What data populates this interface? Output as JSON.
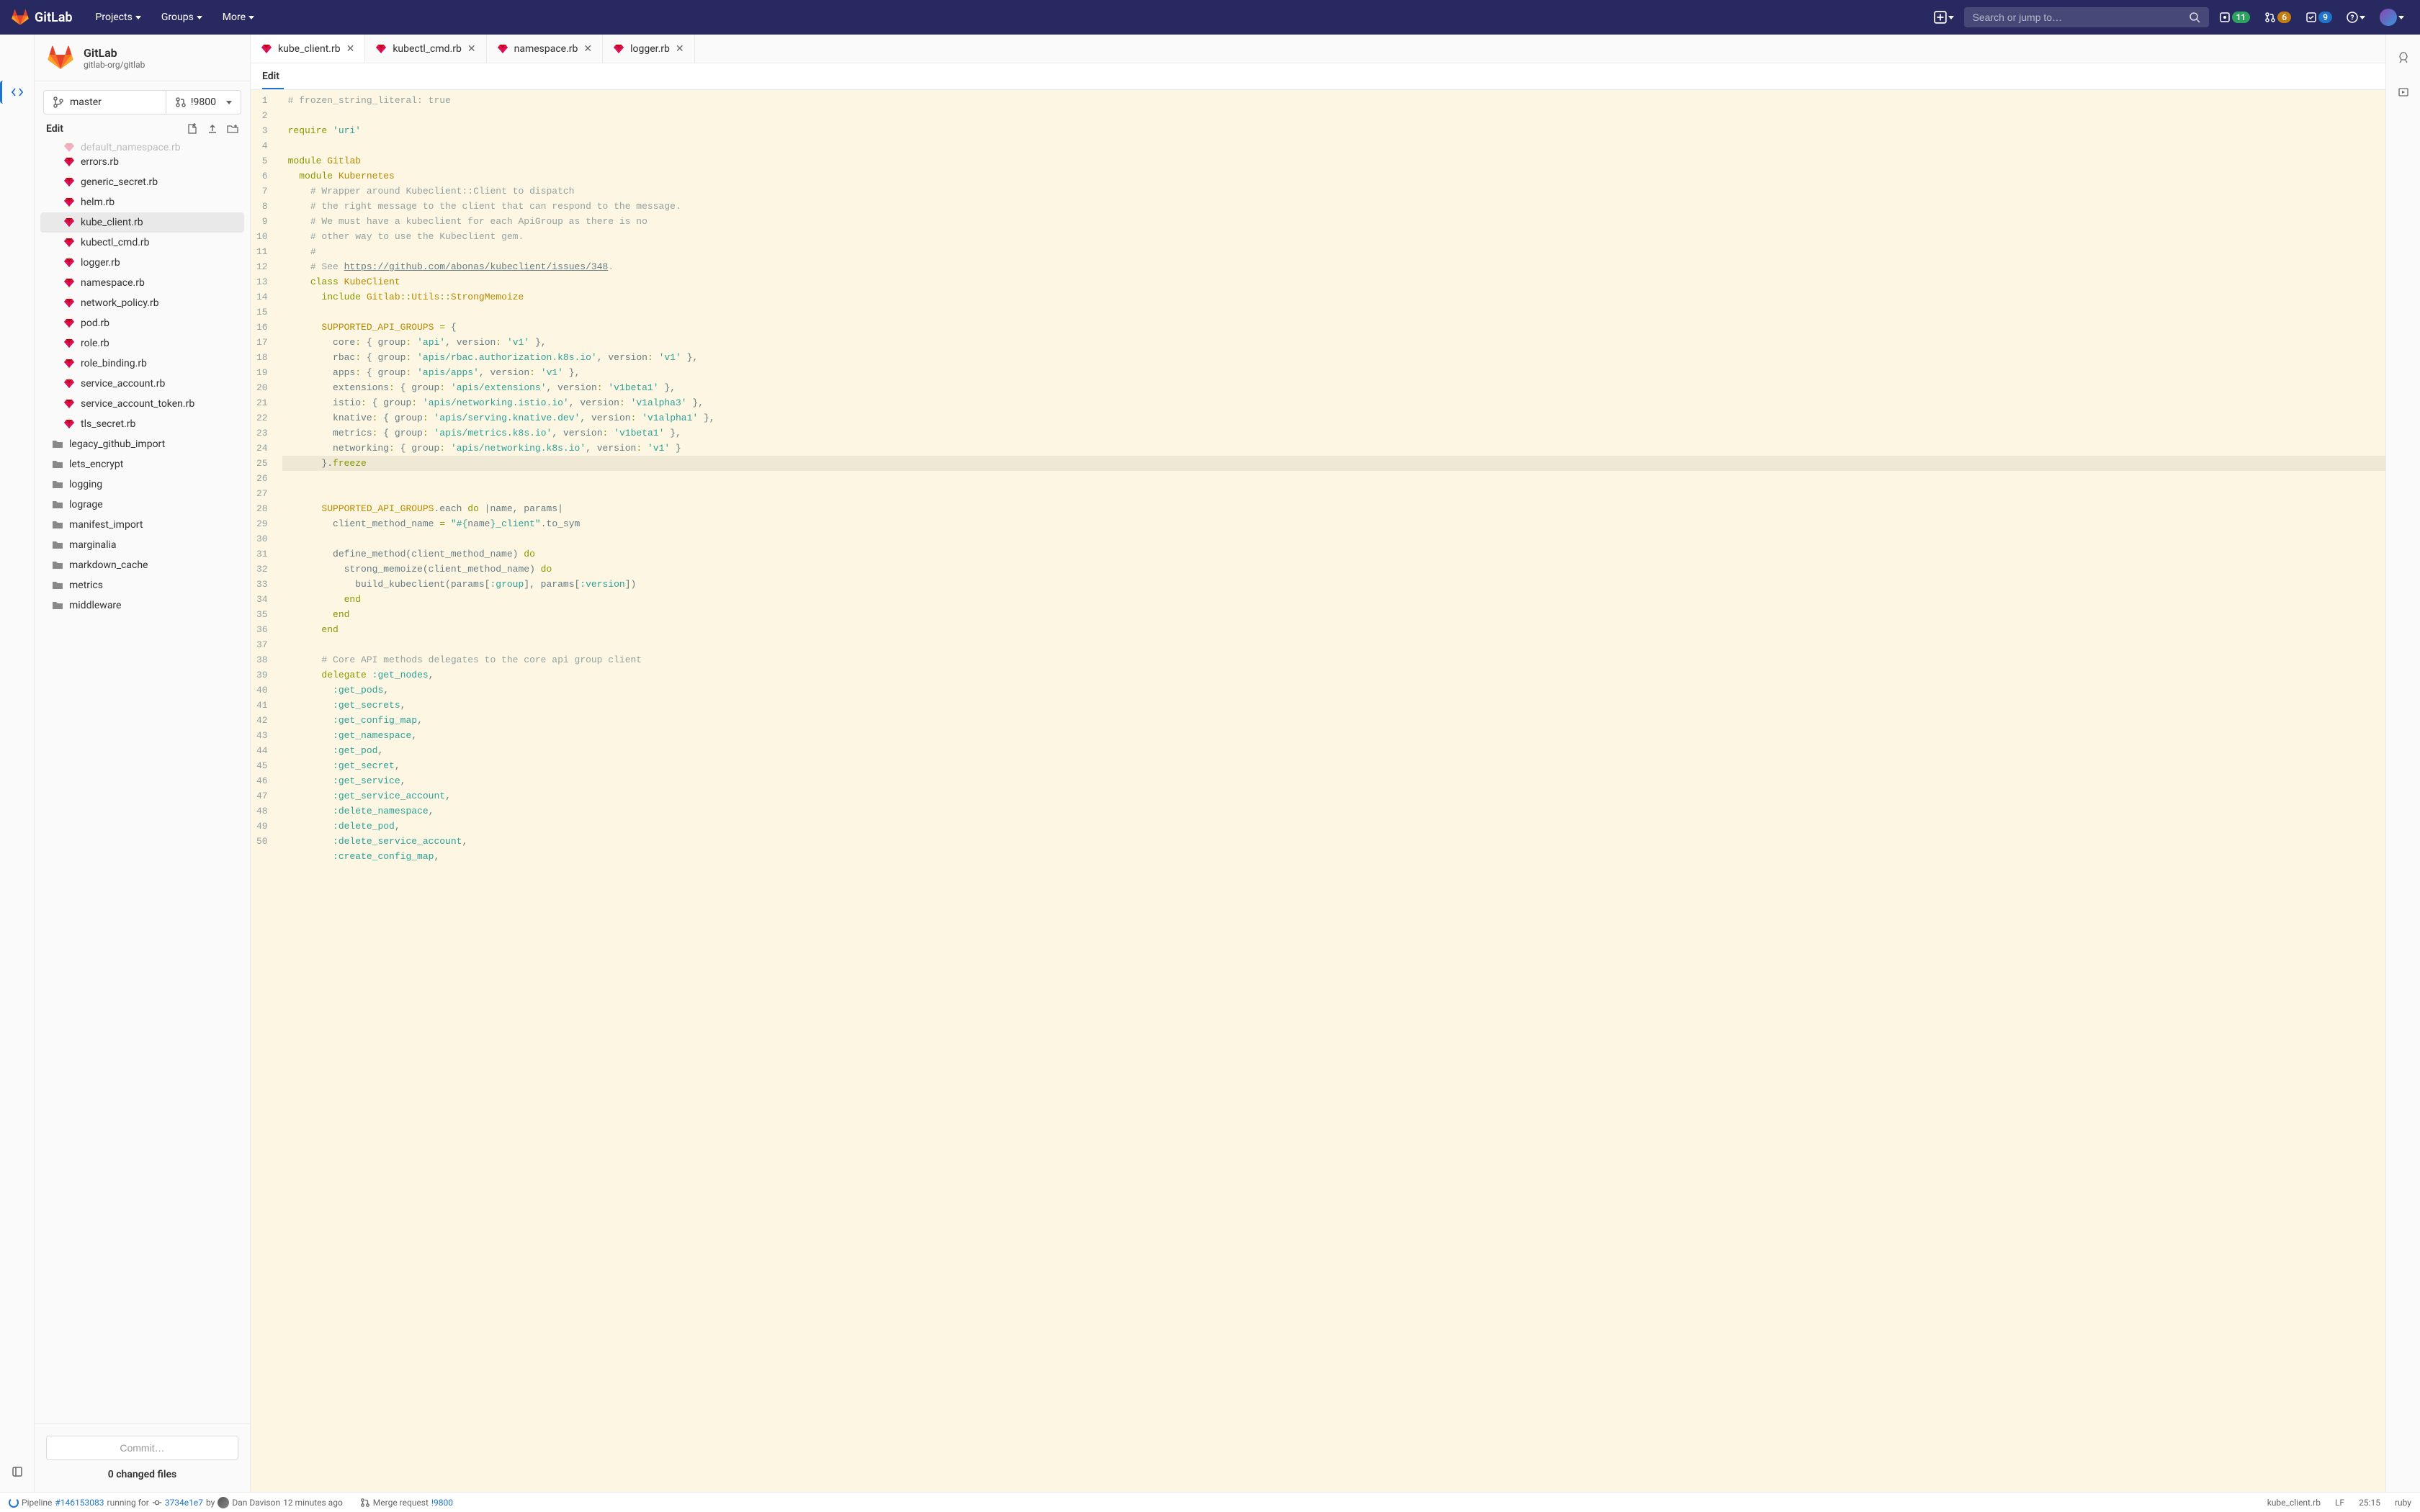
{
  "nav": {
    "brand": "GitLab",
    "projects": "Projects",
    "groups": "Groups",
    "more": "More",
    "search_placeholder": "Search or jump to…",
    "issues_count": "11",
    "mrs_count": "6",
    "todos_count": "9"
  },
  "project": {
    "name": "GitLab",
    "path": "gitlab-org/gitlab"
  },
  "branch": {
    "name": "master",
    "mr": "!9800"
  },
  "sidebar": {
    "edit_label": "Edit",
    "files": [
      {
        "name": "errors.rb",
        "type": "ruby"
      },
      {
        "name": "generic_secret.rb",
        "type": "ruby"
      },
      {
        "name": "helm.rb",
        "type": "ruby"
      },
      {
        "name": "kube_client.rb",
        "type": "ruby",
        "active": true
      },
      {
        "name": "kubectl_cmd.rb",
        "type": "ruby"
      },
      {
        "name": "logger.rb",
        "type": "ruby"
      },
      {
        "name": "namespace.rb",
        "type": "ruby"
      },
      {
        "name": "network_policy.rb",
        "type": "ruby"
      },
      {
        "name": "pod.rb",
        "type": "ruby"
      },
      {
        "name": "role.rb",
        "type": "ruby"
      },
      {
        "name": "role_binding.rb",
        "type": "ruby"
      },
      {
        "name": "service_account.rb",
        "type": "ruby"
      },
      {
        "name": "service_account_token.rb",
        "type": "ruby"
      },
      {
        "name": "tls_secret.rb",
        "type": "ruby"
      },
      {
        "name": "legacy_github_import",
        "type": "folder"
      },
      {
        "name": "lets_encrypt",
        "type": "folder"
      },
      {
        "name": "logging",
        "type": "folder"
      },
      {
        "name": "lograge",
        "type": "folder"
      },
      {
        "name": "manifest_import",
        "type": "folder"
      },
      {
        "name": "marginalia",
        "type": "folder"
      },
      {
        "name": "markdown_cache",
        "type": "folder"
      },
      {
        "name": "metrics",
        "type": "folder"
      },
      {
        "name": "middleware",
        "type": "folder"
      }
    ],
    "commit_btn": "Commit…",
    "changed_files": "0 changed files"
  },
  "tabs": [
    {
      "name": "kube_client.rb",
      "active": true
    },
    {
      "name": "kubectl_cmd.rb"
    },
    {
      "name": "namespace.rb"
    },
    {
      "name": "logger.rb"
    }
  ],
  "breadcrumb": "Edit",
  "code": {
    "url": "https://github.com/abonas/kubeclient/issues/348"
  },
  "status": {
    "pipeline_text": "Pipeline",
    "pipeline_id": "#146153083",
    "running_for": "running for",
    "commit": "3734e1e7",
    "by": "by",
    "author": "Dan Davison",
    "time": "12 minutes ago",
    "mr_label": "Merge request",
    "mr_id": "!9800",
    "file": "kube_client.rb",
    "eol": "LF",
    "pos": "25:15",
    "lang": "ruby"
  }
}
